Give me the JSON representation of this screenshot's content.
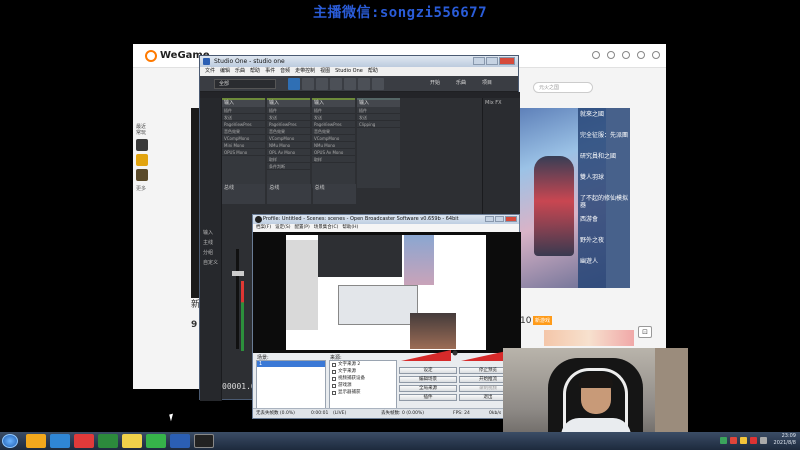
{
  "banner": {
    "text": "主播微信:songzi556677"
  },
  "wegame": {
    "logo": "WeGame",
    "search_placeholder": "元火之国",
    "sidebar": {
      "label1": "最近",
      "label2": "常玩",
      "more": "更多"
    },
    "news_heading": "新",
    "num_left": "9",
    "num_right": "10",
    "tag": "新游戏",
    "game_list": [
      "就來之國",
      "完全征服：先派團",
      "研究員和之國",
      "雙人羽球",
      "了不起的修仙模拟器",
      "西游會",
      "野外之夜",
      "幽遊人"
    ]
  },
  "studio_one": {
    "title": "Studio One - studio one",
    "menu": [
      "文件",
      "编辑",
      "乐曲",
      "帮助",
      "事件",
      "音频",
      "走带控制",
      "视图",
      "Studio One",
      "帮助"
    ],
    "track_dropdown": "全部",
    "right_buttons": [
      "开始",
      "乐曲",
      "项目"
    ],
    "mix_label": "Mix FX",
    "channels": [
      {
        "head": "输入",
        "rows": [
          "插件",
          "发送",
          "PageViewPres",
          "音色效果",
          "VCompMono",
          "Mini Mono",
          "OPUS Mono"
        ]
      },
      {
        "head": "输入",
        "rows": [
          "插件",
          "发送",
          "PageViewPres",
          "音色效果",
          "VCompMono",
          "NMu Mono",
          "OPL Av Mono",
          "取样",
          "条件判断"
        ]
      },
      {
        "head": "输入",
        "rows": [
          "插件",
          "发送",
          "PageViewPres",
          "音色效果",
          "VCompMono",
          "NMu Mono",
          "OPUS Av Mono",
          "取样"
        ]
      },
      {
        "head": "输入",
        "rows": [
          "插件",
          "发送",
          "Clipping"
        ]
      }
    ],
    "side_labels": [
      "输入",
      "主线",
      "分组",
      "自定义"
    ],
    "lower_labels": [
      "总线",
      "总线",
      "总线"
    ],
    "counter": "00001.0"
  },
  "obs": {
    "title": "Profile: Untitled - Scenes: scenes - Open Broadcaster Software v0.659b - 64bit",
    "menu": [
      "档案(F)",
      "设定(S)",
      "配置(P)",
      "场景集合(C)",
      "帮助(H)"
    ],
    "scenes_label": "场景:",
    "sources_label": "来源:",
    "scenes": [
      "1"
    ],
    "sources": [
      "文字来源 2",
      "文字来源",
      "视频捕获设备",
      "游戏源",
      "显示器捕获"
    ],
    "buttons": [
      "设定",
      "停止预览",
      "编辑场景",
      "开始推流",
      "全局来源",
      "录制视频",
      "插件",
      "退出"
    ],
    "disabled_buttons": [
      "录制视频"
    ],
    "status": {
      "dropped": "无丢失帧数 (0.0%)",
      "time": "0:00:01",
      "live": "(LIVE)",
      "frames": "丢失帧数: 0 (0.00%)",
      "fps": "FPS: 24",
      "rate": "0kb/s"
    }
  },
  "taskbar": {
    "clock_time": "23:09",
    "clock_date": "2021/8/8",
    "icons": [
      "ie-icon",
      "wegame-icon",
      "edge-icon",
      "netease-icon",
      "media-icon",
      "qq-icon",
      "greenapp-icon",
      "studio-one-icon",
      "obs-icon"
    ]
  }
}
